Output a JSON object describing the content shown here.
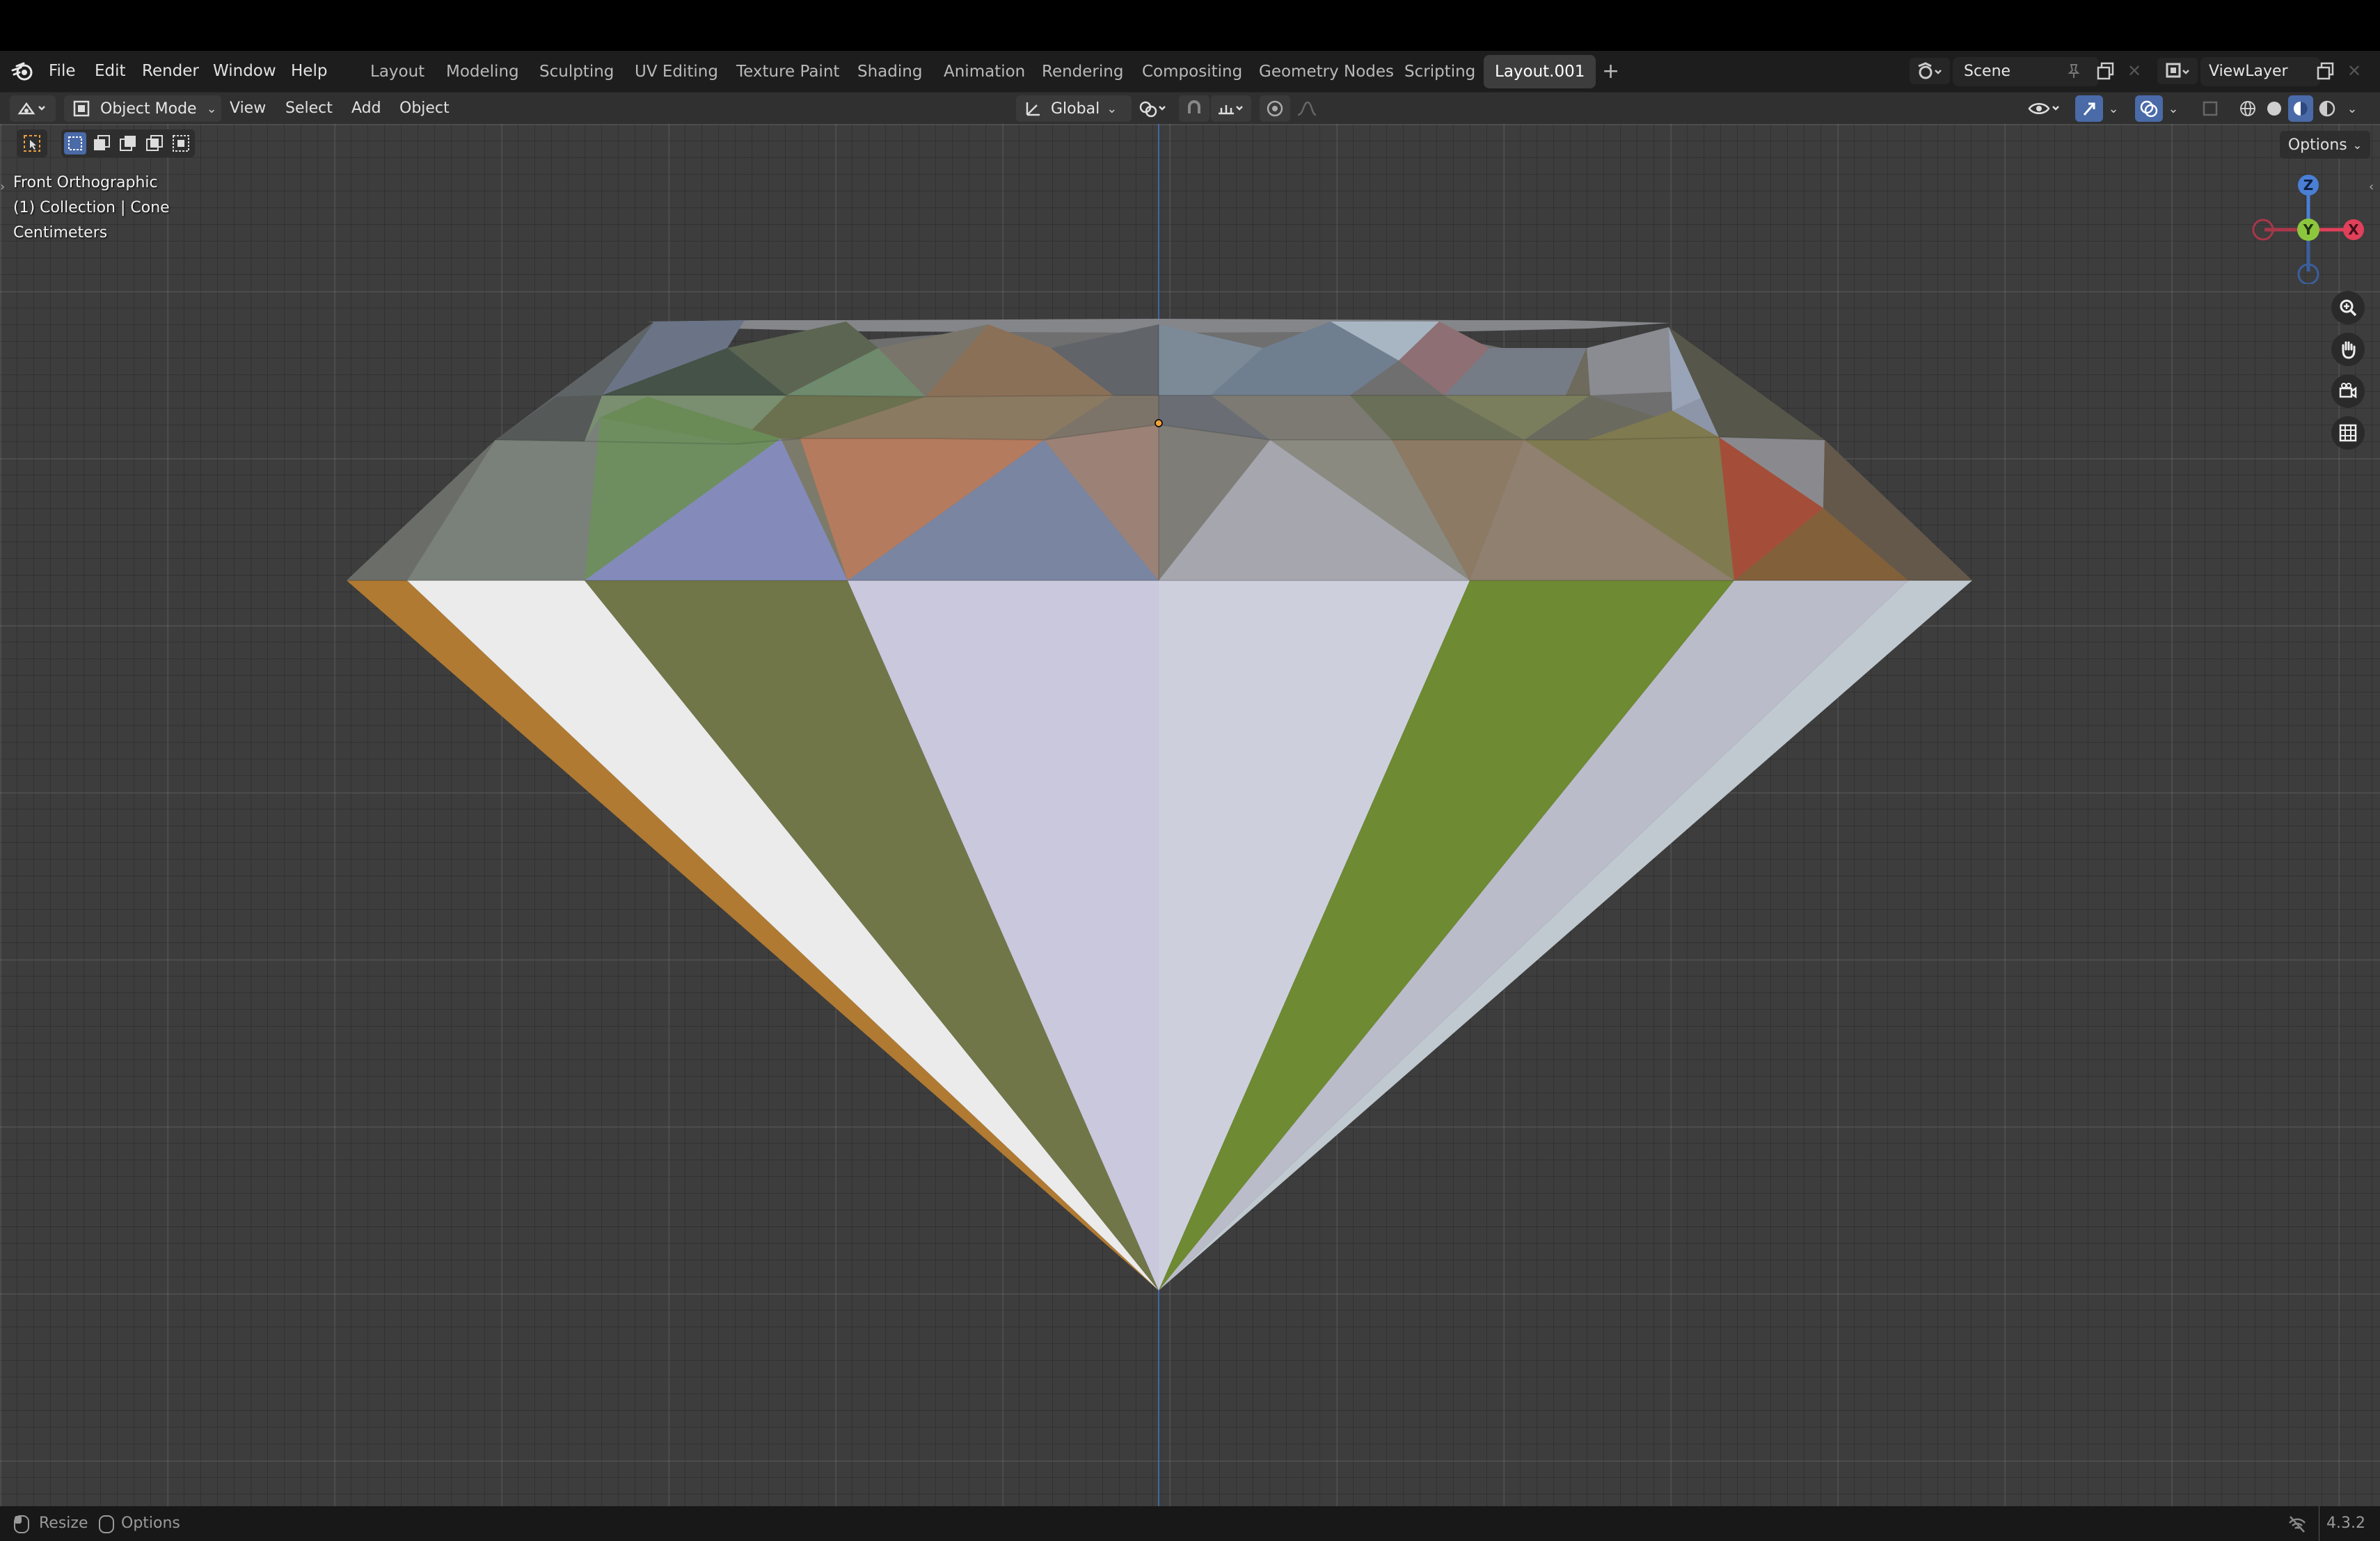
{
  "menus": [
    "File",
    "Edit",
    "Render",
    "Window",
    "Help"
  ],
  "workspaces": [
    "Layout",
    "Modeling",
    "Sculpting",
    "UV Editing",
    "Texture Paint",
    "Shading",
    "Animation",
    "Rendering",
    "Compositing",
    "Geometry Nodes",
    "Scripting",
    "Layout.001"
  ],
  "active_workspace": "Layout.001",
  "add_workspace": "+",
  "scene_name": "Scene",
  "view_layer_name": "ViewLayer",
  "header": {
    "mode": "Object Mode",
    "menus": [
      "View",
      "Select",
      "Add",
      "Object"
    ],
    "transform_orientation": "Global",
    "options_label": "Options"
  },
  "viewport": {
    "view_name": "Front Orthographic",
    "collection_info": "(1) Collection | Cone",
    "units": "Centimeters",
    "gizmo_axes": {
      "z": "Z",
      "y": "Y",
      "x": "X"
    },
    "colors": {
      "x_axis": "#e0405a",
      "y_axis": "#8cc63e",
      "z_axis": "#4a7fd6",
      "origin": "#f2a03a",
      "vertical_line": "#3f6fb8"
    }
  },
  "statusbar": {
    "left": [
      "Resize",
      "Options"
    ],
    "version": "4.3.2"
  },
  "icons": [
    "blender-logo-icon",
    "editor-type-icon",
    "select-box-icon",
    "transform-orientation-icon",
    "pivot-icon",
    "snap-icon",
    "proportional-edit-icon",
    "visibility-icon",
    "gizmo-icon",
    "overlay-icon",
    "xray-icon",
    "shading-wireframe-icon",
    "shading-solid-icon",
    "shading-material-icon",
    "shading-rendered-icon",
    "zoom-icon",
    "hand-icon",
    "camera-icon",
    "grid-icon",
    "mouse-icon",
    "network-off-icon"
  ]
}
